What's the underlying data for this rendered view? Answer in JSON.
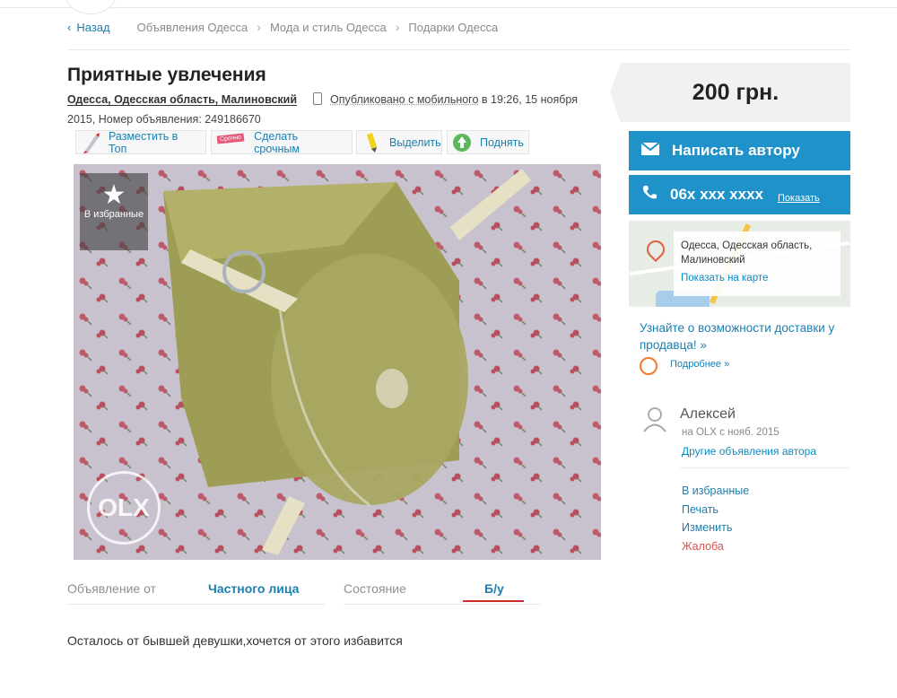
{
  "breadcrumb": {
    "back_label": "Назад",
    "items": [
      "Объявления Одесса",
      "Мода и стиль Одесса",
      "Подарки Одесса"
    ]
  },
  "listing": {
    "title": "Приятные увлечения",
    "location": "Одесса, Одесская область, Малиновский",
    "published": "Опубликовано с мобильного",
    "published_time": "в 19:26, 15 ноября 2015,",
    "id_label": "Номер объявления: 249186670"
  },
  "promo": {
    "top": "Разместить в Топ",
    "urgent": "Сделать срочным",
    "urgent_tag": "Срочно",
    "highlight": "Выделить",
    "raise": "Поднять"
  },
  "photo": {
    "favorite_label": "В избранные",
    "watermark": "OLX"
  },
  "params": {
    "from_label": "Объявление от",
    "from_value": "Частного лица",
    "condition_label": "Состояние",
    "condition_value": "Б/у"
  },
  "description": "Осталось от бывшей девушки,хочется от этого избавится",
  "sidebar": {
    "price": "200 грн.",
    "write_author": "Написать автору",
    "phone": "06x xxx xxxx",
    "show_phone": "Показать",
    "map_address_line1": "Одесса, Одесская область,",
    "map_address_line2": "Малиновский",
    "show_on_map": "Показать на карте",
    "delivery_text": "Узнайте о возможности доставки у продавца! »",
    "more": "Подробнее »",
    "user_name": "Алексей",
    "user_since": "на OLX с нояб. 2015",
    "other_ads": "Другие объявления автора",
    "links": [
      "В избранные",
      "Печать",
      "Изменить",
      "Жалоба"
    ]
  },
  "colors": {
    "accent": "#1e92c9",
    "link": "#1b7fb0",
    "complaint": "#d9534f",
    "underline_red": "#d02a2a"
  }
}
